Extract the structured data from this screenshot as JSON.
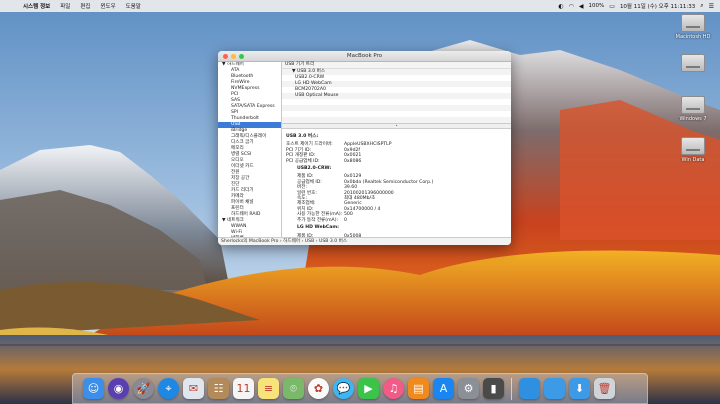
{
  "menubar": {
    "app_name": "시스템 정보",
    "items": [
      "파일",
      "편집",
      "윈도우",
      "도움말"
    ],
    "battery": "100%",
    "clock": "10월 11일 (수) 오후 11:11:33"
  },
  "desktop_icons": [
    {
      "label": "Macintosh HD"
    },
    {
      "label": ""
    },
    {
      "label": "Windows 7"
    },
    {
      "label": "Win Data"
    }
  ],
  "window": {
    "title": "MacBook Pro",
    "sidebar": [
      {
        "label": "▼ 하드웨어",
        "group": true
      },
      {
        "label": "ATA"
      },
      {
        "label": "Bluetooth"
      },
      {
        "label": "FireWire"
      },
      {
        "label": "NVMExpress"
      },
      {
        "label": "PCI"
      },
      {
        "label": "SAS"
      },
      {
        "label": "SATA/SATA Express"
      },
      {
        "label": "SPI"
      },
      {
        "label": "Thunderbolt"
      },
      {
        "label": "USB",
        "selected": true
      },
      {
        "label": "iBridge"
      },
      {
        "label": "그래픽/디스플레이"
      },
      {
        "label": "디스크 굽기"
      },
      {
        "label": "메모리"
      },
      {
        "label": "병렬 SCSI"
      },
      {
        "label": "오디오"
      },
      {
        "label": "이더넷 카드"
      },
      {
        "label": "전원"
      },
      {
        "label": "저장 공간"
      },
      {
        "label": "진단"
      },
      {
        "label": "카드 리더기"
      },
      {
        "label": "카메라"
      },
      {
        "label": "파이버 채널"
      },
      {
        "label": "프린터"
      },
      {
        "label": "하드웨어 RAID"
      },
      {
        "label": "▼ 네트워크",
        "group": true
      },
      {
        "label": "WWAN"
      },
      {
        "label": "Wi-Fi"
      },
      {
        "label": "방화벽"
      }
    ],
    "tree_header": "USB 기기 트리",
    "tree": [
      {
        "label": "▼ USB 3.0 버스",
        "level": 1
      },
      {
        "label": "USB2.0-CRW",
        "level": 2
      },
      {
        "label": "LG HD WebCam",
        "level": 2
      },
      {
        "label": "BCM20702A0",
        "level": 2
      },
      {
        "label": "USB Optical Mouse",
        "level": 2
      }
    ],
    "detail": {
      "bus_title": "USB 3.0 버스:",
      "bus_fields": [
        {
          "k": "호스트 제어기 드라이버:",
          "v": "AppleUSBXHCISPTLP"
        },
        {
          "k": "PCI 기기 ID:",
          "v": "0x9d2f"
        },
        {
          "k": "PCI 개정판 ID:",
          "v": "0x0021"
        },
        {
          "k": "PCI 공급업체 ID:",
          "v": "0x8086"
        }
      ],
      "dev1_title": "USB2.0-CRW:",
      "dev1_fields": [
        {
          "k": "제품 ID:",
          "v": "0x0129"
        },
        {
          "k": "공급업체 ID:",
          "v": "0x0bda  (Realtek Semiconductor Corp.)"
        },
        {
          "k": "버전:",
          "v": "39.60"
        },
        {
          "k": "일련 번호:",
          "v": "20100201396000000"
        },
        {
          "k": "속도:",
          "v": "최대 480Mb/초"
        },
        {
          "k": "제조업체:",
          "v": "Generic"
        },
        {
          "k": "위치 ID:",
          "v": "0x14700000 / 4"
        },
        {
          "k": "사용 가능한 전류(mA):",
          "v": "500"
        },
        {
          "k": "추가 동작 전류(mA):",
          "v": "0"
        }
      ],
      "dev2_title": "LG HD WebCam:",
      "dev2_fields": [
        {
          "k": "제품 ID:",
          "v": "0x5008"
        }
      ]
    },
    "pathbar": "Sherlocks의 MacBook Pro  ›  하드웨어  ›  USB  ›  USB 3.0 버스"
  },
  "dock": [
    {
      "name": "finder-icon",
      "glyph": "☺",
      "color": "#3c8ee8"
    },
    {
      "name": "siri-icon",
      "glyph": "◉",
      "color": "#5a3fb0",
      "round": true
    },
    {
      "name": "launchpad-icon",
      "glyph": "🚀",
      "color": "#8a8a94",
      "round": true
    },
    {
      "name": "safari-icon",
      "glyph": "⌖",
      "color": "#1e88e5",
      "round": true
    },
    {
      "name": "mail-icon",
      "glyph": "✉",
      "color": "#dfe6ee"
    },
    {
      "name": "contacts-icon",
      "glyph": "☷",
      "color": "#b38a5a"
    },
    {
      "name": "calendar-icon",
      "glyph": "11",
      "color": "#f5f5f5"
    },
    {
      "name": "notes-icon",
      "glyph": "≡",
      "color": "#f7e37a"
    },
    {
      "name": "maps-icon",
      "glyph": "⌾",
      "color": "#7ab86a"
    },
    {
      "name": "photos-icon",
      "glyph": "✿",
      "color": "#fafafa",
      "round": true
    },
    {
      "name": "messages-icon",
      "glyph": "💬",
      "color": "#3db6f5",
      "round": true
    },
    {
      "name": "facetime-icon",
      "glyph": "▶",
      "color": "#3cc34a"
    },
    {
      "name": "itunes-icon",
      "glyph": "♫",
      "color": "#f25a88",
      "round": true
    },
    {
      "name": "ibooks-icon",
      "glyph": "▤",
      "color": "#f0891e"
    },
    {
      "name": "appstore-icon",
      "glyph": "A",
      "color": "#1b86f0"
    },
    {
      "name": "system-preferences-icon",
      "glyph": "⚙",
      "color": "#8b8f96"
    },
    {
      "name": "system-information-icon",
      "glyph": "▮",
      "color": "#4a4a4a"
    },
    {
      "name": "downloads-folder-icon",
      "glyph": "",
      "color": "#2f8fe0",
      "separator_before": true
    },
    {
      "name": "documents-folder-icon",
      "glyph": "",
      "color": "#3d9ae6"
    },
    {
      "name": "downloads-stack-icon",
      "glyph": "⬇",
      "color": "#3d9ae6"
    },
    {
      "name": "trash-icon",
      "glyph": "🗑",
      "color": "#cfd4d8"
    }
  ]
}
